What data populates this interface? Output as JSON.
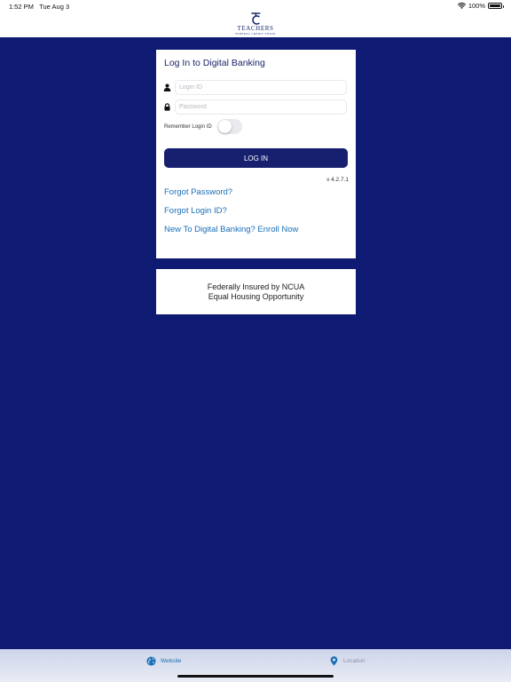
{
  "status_bar": {
    "time": "1:52 PM",
    "date": "Tue Aug 3",
    "battery": "100%"
  },
  "logo": {
    "name": "TEACHERS",
    "subtitle": "FEDERAL CREDIT UNION",
    "icon": "teachers-logo-icon"
  },
  "login": {
    "title": "Log In to Digital Banking",
    "login_id_placeholder": "Login ID",
    "login_id_value": "",
    "password_placeholder": "Password",
    "password_value": "",
    "remember_label": "Remember Login ID",
    "remember_on": false,
    "button_label": "LOG IN",
    "version": "v 4.2.7.1",
    "links": {
      "forgot_password": "Forgot Password?",
      "forgot_login_id": "Forgot Login ID?",
      "enroll": "New To Digital Banking? Enroll Now"
    }
  },
  "disclosure": {
    "line1": "Federally Insured by NCUA",
    "line2": "Equal Housing Opportunity"
  },
  "tabbar": {
    "website_label": "Website",
    "location_label": "Location"
  },
  "colors": {
    "background": "#0f1a72",
    "button": "#16206f",
    "link": "#1b6fb6"
  }
}
